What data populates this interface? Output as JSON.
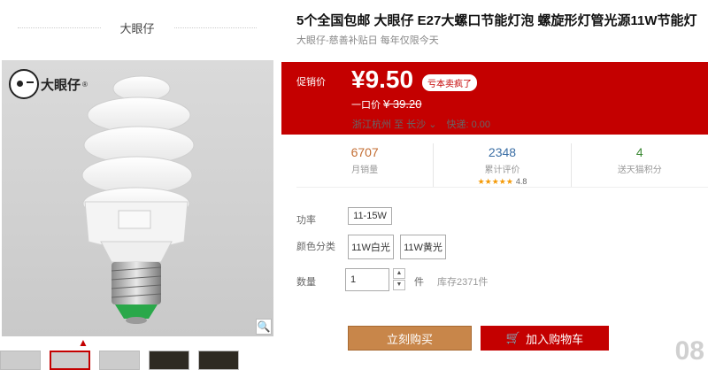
{
  "shop": {
    "name": "大眼仔"
  },
  "image": {
    "logo_text": "大眼仔",
    "logo_reg": "®",
    "zoom_icon": "magnifier-icon"
  },
  "product": {
    "title": "5个全国包邮 大眼仔 E27大螺口节能灯泡 螺旋形灯管光源11W节能灯",
    "subtitle": "大眼仔-慈善补贴日 每年仅限今天"
  },
  "price": {
    "label": "促销价",
    "value": "¥9.50",
    "badge": "亏本卖疯了",
    "original_label": "一口价",
    "original_value": "¥ 39.20"
  },
  "shipping": {
    "from": "浙江杭州",
    "to_label": "至",
    "to": "长沙",
    "fee": "快递: 0.00"
  },
  "stats": [
    {
      "value": "6707",
      "label": "月销量"
    },
    {
      "value": "2348",
      "label": "累计评价",
      "stars": "★★★★★",
      "score": "4.8"
    },
    {
      "value": "4",
      "label": "送天猫积分"
    }
  ],
  "attributes": {
    "power_label": "功率",
    "power_option": "11-15W",
    "color_label": "颜色分类",
    "color_options": [
      "11W白光",
      "11W黄光"
    ],
    "qty_label": "数量",
    "qty_value": "1",
    "qty_unit": "件",
    "stock": "库存2371件"
  },
  "actions": {
    "buy": "立刻购买",
    "cart": "加入购物车"
  },
  "watermark": "08"
}
